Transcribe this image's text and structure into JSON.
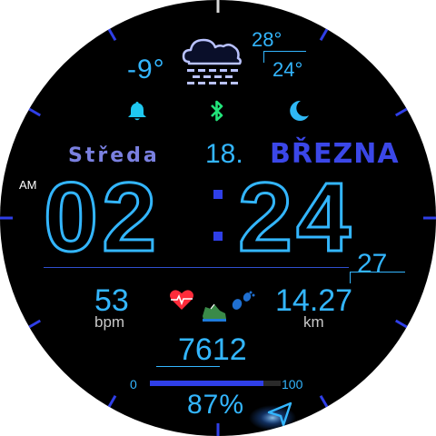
{
  "weather": {
    "current_temp": "-9°",
    "high_temp": "28°",
    "low_temp": "24°",
    "icon": "cloud-snow-icon"
  },
  "status_icons": [
    "bell-icon",
    "bluetooth-icon",
    "moon-icon"
  ],
  "date": {
    "weekday": "Středa",
    "day": "18.",
    "month": "BŘEZNA"
  },
  "time": {
    "ampm": "AM",
    "hours": "02",
    "minutes": "24",
    "seconds": "27"
  },
  "heart_rate": {
    "value": "53",
    "unit": "bpm",
    "icon": "heart-pulse-icon"
  },
  "distance": {
    "value": "14.27",
    "unit": "km",
    "icon": "walking-shoe-icon"
  },
  "steps": {
    "value": "7612"
  },
  "battery": {
    "min_label": "0",
    "max_label": "100",
    "percent_label": "87%",
    "level": 0.87,
    "icon": "send-arrow-icon"
  },
  "colors": {
    "digits": "#33b6ff",
    "accent": "#2f3fe8",
    "weekday": "#7a80e0",
    "bell": "#1fc8f0",
    "bluetooth": "#22e37a",
    "moon": "#2fb8f5",
    "heart": "#ff2b3a"
  }
}
